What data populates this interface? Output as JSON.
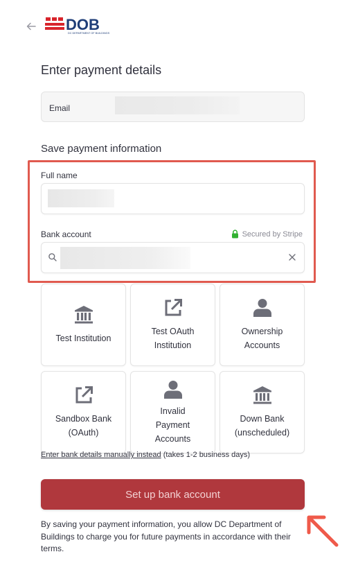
{
  "header": {
    "back_icon": "arrow-left-icon",
    "logo": {
      "text": "DOB",
      "subtext": "DC DEPARTMENT OF BUILDINGS",
      "color": "#1f3e78",
      "flag_color": "#d8242c"
    }
  },
  "payment": {
    "title": "Enter payment details",
    "email_label": "Email",
    "save_title": "Save payment information",
    "full_name_label": "Full name",
    "bank_account_label": "Bank account",
    "secured_text": "Secured by Stripe"
  },
  "banks": [
    {
      "label": "Test Institution",
      "icon": "bank-icon"
    },
    {
      "label": "Test OAuth\nInstitution",
      "icon": "external-link-icon"
    },
    {
      "label": "Ownership\nAccounts",
      "icon": "person-icon"
    },
    {
      "label": "Sandbox Bank\n(OAuth)",
      "icon": "external-link-icon"
    },
    {
      "label": "Invalid\nPayment\nAccounts",
      "icon": "person-icon"
    },
    {
      "label": "Down Bank\n(unscheduled)",
      "icon": "bank-icon"
    }
  ],
  "manual": {
    "link_text": "Enter bank details manually instead",
    "suffix": " (takes 1-2 business days)"
  },
  "submit_label": "Set up bank account",
  "consent_text": "By saving your payment information, you allow DC Department of Buildings to charge you for future payments in accordance with their terms.",
  "colors": {
    "accent": "#b0383d",
    "highlight": "#e05a4f",
    "secured_lock": "#30b130",
    "icon_gray": "#6d6e78"
  }
}
